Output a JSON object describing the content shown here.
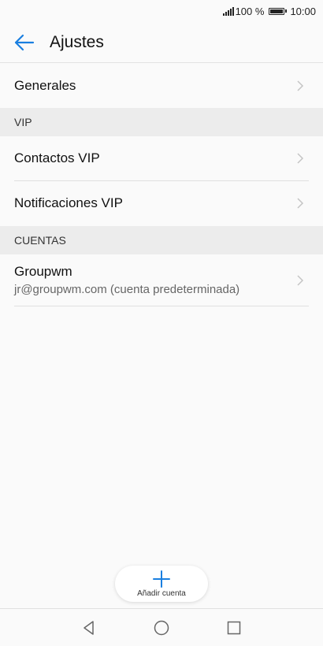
{
  "status_bar": {
    "battery_text": "100 %",
    "time": "10:00"
  },
  "app_bar": {
    "title": "Ajustes",
    "back_icon": "arrow-left-icon"
  },
  "general": {
    "label": "Generales"
  },
  "vip_section": {
    "header": "VIP",
    "items": [
      {
        "label": "Contactos VIP"
      },
      {
        "label": "Notificaciones VIP"
      }
    ]
  },
  "accounts_section": {
    "header": "CUENTAS",
    "account": {
      "name": "Groupwm",
      "detail": "jr@groupwm.com (cuenta predeterminada)"
    }
  },
  "add_account": {
    "label": "Añadir cuenta",
    "icon": "plus-icon"
  },
  "colors": {
    "accent": "#1a7fe0",
    "background": "#fafafa",
    "section_bg": "#ececec"
  }
}
